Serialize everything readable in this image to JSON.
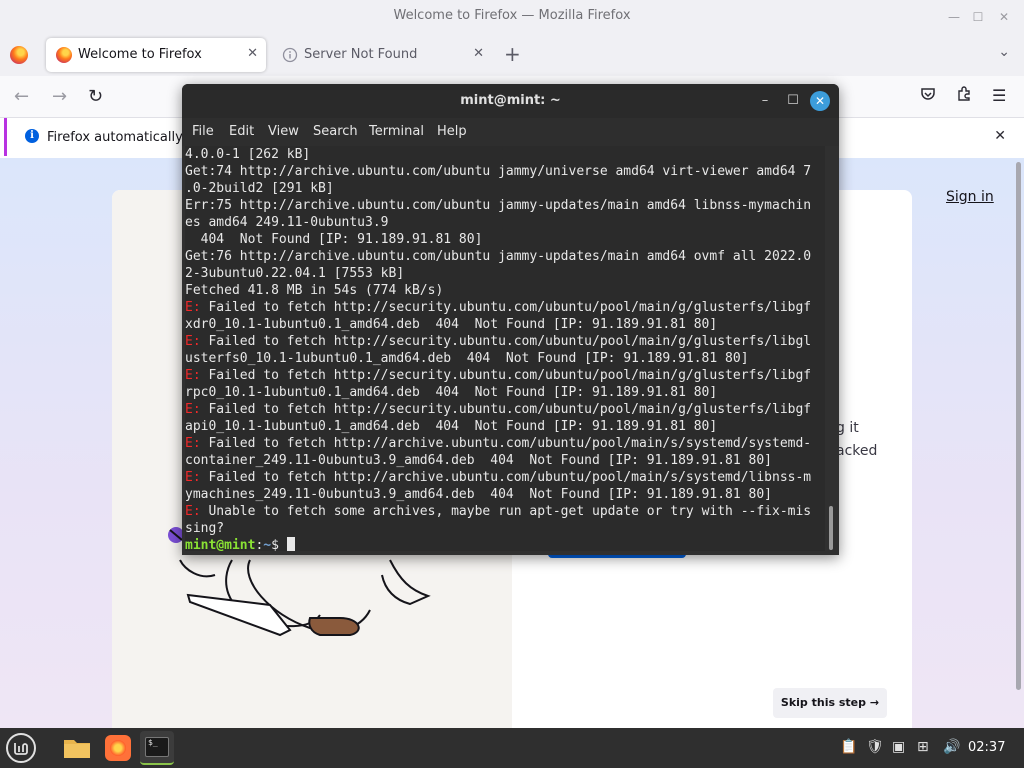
{
  "firefox": {
    "window_title": "Welcome to Firefox — Mozilla Firefox",
    "tabs": [
      {
        "label": "Welcome to Firefox",
        "close": "✕"
      },
      {
        "label": "Server Not Found",
        "close": "✕"
      }
    ],
    "new_tab": "+",
    "infobar": {
      "icon": "i",
      "text": "Firefox automatically se",
      "close": "✕"
    },
    "page": {
      "sign_in": "Sign in",
      "partial_line_1": "g it",
      "partial_line_2": "acked",
      "skip_button": "Skip this step →"
    }
  },
  "terminal": {
    "title": "mint@mint: ~",
    "menu": [
      "File",
      "Edit",
      "View",
      "Search",
      "Terminal",
      "Help"
    ],
    "lines": [
      {
        "prefix": "",
        "text": "4.0.0-1 [262 kB]"
      },
      {
        "prefix": "",
        "text": "Get:74 http://archive.ubuntu.com/ubuntu jammy/universe amd64 virt-viewer amd64 7"
      },
      {
        "prefix": "",
        "text": ".0-2build2 [291 kB]"
      },
      {
        "prefix": "",
        "text": "Err:75 http://archive.ubuntu.com/ubuntu jammy-updates/main amd64 libnss-mymachin"
      },
      {
        "prefix": "",
        "text": "es amd64 249.11-0ubuntu3.9"
      },
      {
        "prefix": "",
        "text": "  404  Not Found [IP: 91.189.91.81 80]"
      },
      {
        "prefix": "",
        "text": "Get:76 http://archive.ubuntu.com/ubuntu jammy-updates/main amd64 ovmf all 2022.0"
      },
      {
        "prefix": "",
        "text": "2-3ubuntu0.22.04.1 [7553 kB]"
      },
      {
        "prefix": "",
        "text": "Fetched 41.8 MB in 54s (774 kB/s)"
      },
      {
        "prefix": "E:",
        "text": " Failed to fetch http://security.ubuntu.com/ubuntu/pool/main/g/glusterfs/libgf"
      },
      {
        "prefix": "",
        "text": "xdr0_10.1-1ubuntu0.1_amd64.deb  404  Not Found [IP: 91.189.91.81 80]"
      },
      {
        "prefix": "E:",
        "text": " Failed to fetch http://security.ubuntu.com/ubuntu/pool/main/g/glusterfs/libgl"
      },
      {
        "prefix": "",
        "text": "usterfs0_10.1-1ubuntu0.1_amd64.deb  404  Not Found [IP: 91.189.91.81 80]"
      },
      {
        "prefix": "E:",
        "text": " Failed to fetch http://security.ubuntu.com/ubuntu/pool/main/g/glusterfs/libgf"
      },
      {
        "prefix": "",
        "text": "rpc0_10.1-1ubuntu0.1_amd64.deb  404  Not Found [IP: 91.189.91.81 80]"
      },
      {
        "prefix": "E:",
        "text": " Failed to fetch http://security.ubuntu.com/ubuntu/pool/main/g/glusterfs/libgf"
      },
      {
        "prefix": "",
        "text": "api0_10.1-1ubuntu0.1_amd64.deb  404  Not Found [IP: 91.189.91.81 80]"
      },
      {
        "prefix": "E:",
        "text": " Failed to fetch http://archive.ubuntu.com/ubuntu/pool/main/s/systemd/systemd-"
      },
      {
        "prefix": "",
        "text": "container_249.11-0ubuntu3.9_amd64.deb  404  Not Found [IP: 91.189.91.81 80]"
      },
      {
        "prefix": "E:",
        "text": " Failed to fetch http://archive.ubuntu.com/ubuntu/pool/main/s/systemd/libnss-m"
      },
      {
        "prefix": "",
        "text": "ymachines_249.11-0ubuntu3.9_amd64.deb  404  Not Found [IP: 91.189.91.81 80]"
      },
      {
        "prefix": "E:",
        "text": " Unable to fetch some archives, maybe run apt-get update or try with --fix-mis"
      },
      {
        "prefix": "",
        "text": "sing?"
      }
    ],
    "prompt_user": "mint@mint",
    "prompt_sep": ":",
    "prompt_path": "~",
    "prompt_end": "$ "
  },
  "taskbar": {
    "clock": "02:37",
    "apps": [
      "files-icon",
      "firefox-icon",
      "terminal-icon"
    ]
  },
  "colors": {
    "error": "#ef2929",
    "prompt_user": "#8ae234",
    "prompt_path": "#729fcf",
    "accent_blue": "#0061e0"
  }
}
